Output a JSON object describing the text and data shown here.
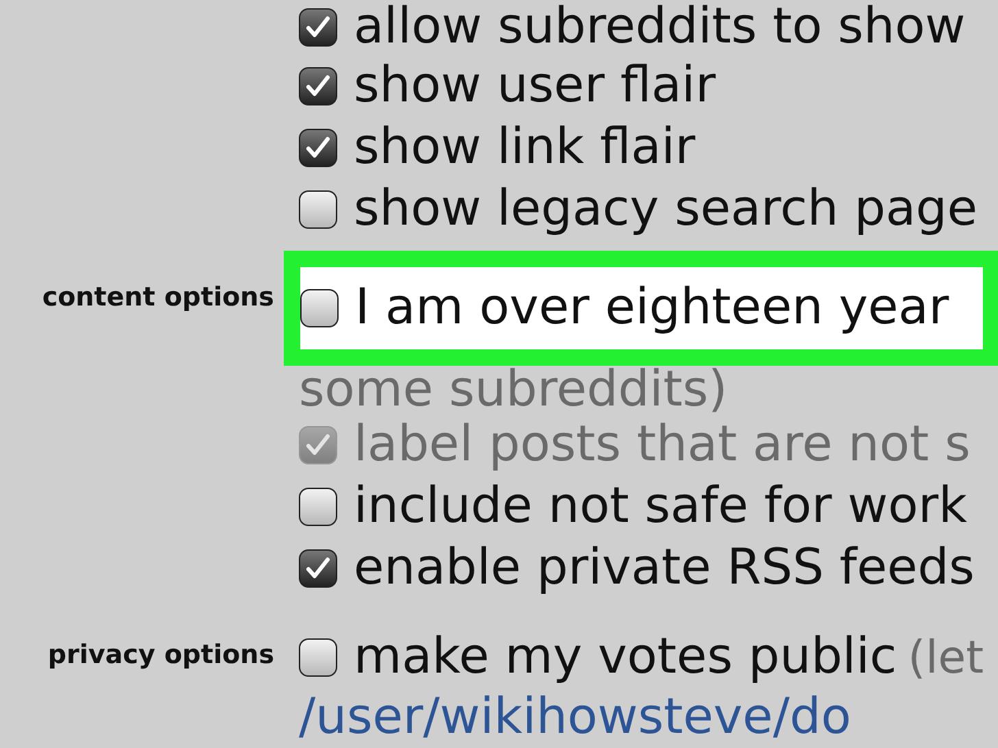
{
  "sections": [
    {
      "options": [
        {
          "kind": "checkbox",
          "text": "allow subreddits to show",
          "checked": true,
          "disabled": false,
          "highlighted": false
        },
        {
          "kind": "checkbox",
          "text": "show user flair",
          "checked": true,
          "disabled": false,
          "highlighted": false
        },
        {
          "kind": "checkbox",
          "text": "show link flair",
          "checked": true,
          "disabled": false,
          "highlighted": false
        },
        {
          "kind": "checkbox",
          "text": "show legacy search page",
          "checked": false,
          "disabled": false,
          "highlighted": false
        }
      ]
    },
    {
      "label": "content options",
      "options": [
        {
          "kind": "checkbox",
          "text": "I am over eighteen year",
          "checked": false,
          "disabled": false,
          "highlighted": true
        },
        {
          "kind": "note",
          "text": "some subreddits)"
        },
        {
          "kind": "checkbox",
          "text": "label posts that are not s",
          "checked": true,
          "disabled": true,
          "highlighted": false
        },
        {
          "kind": "checkbox",
          "text": "include not safe for work",
          "checked": false,
          "disabled": false,
          "highlighted": false
        },
        {
          "kind": "checkbox",
          "text": "enable private RSS feeds",
          "checked": true,
          "disabled": false,
          "highlighted": false
        }
      ]
    },
    {
      "label": "privacy options",
      "options": [
        {
          "kind": "checkbox",
          "text": "make my votes public",
          "hint": "(let",
          "checked": false,
          "disabled": false,
          "highlighted": false
        },
        {
          "kind": "link",
          "text": "/user/wikihowsteve/do"
        }
      ]
    }
  ]
}
